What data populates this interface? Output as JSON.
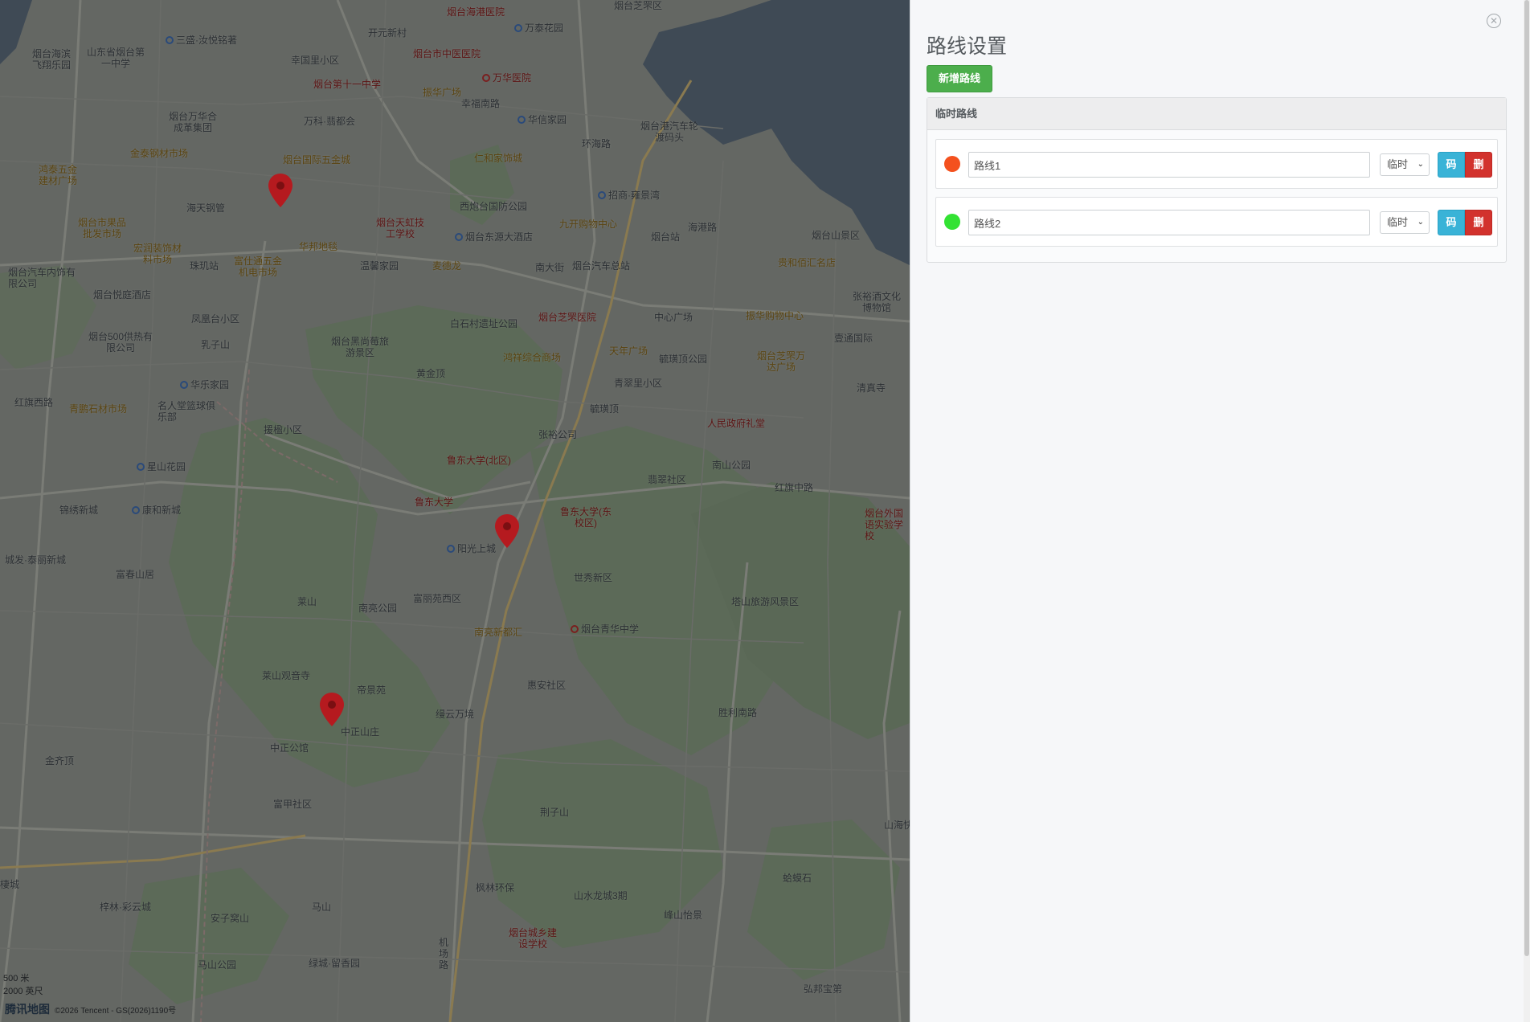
{
  "panel": {
    "title": "路线设置",
    "add_button": "新增路线",
    "close_symbol": "✕",
    "box_header": "临时路线",
    "routes": [
      {
        "color": "#f4511e",
        "name": "路线1",
        "type": "临时",
        "code_label": "码",
        "delete_label": "删"
      },
      {
        "color": "#33e233",
        "name": "路线2",
        "type": "临时",
        "code_label": "码",
        "delete_label": "删"
      }
    ]
  },
  "map": {
    "scale_metric": "500 米",
    "scale_imperial": "2000 英尺",
    "brand": "腾讯地图",
    "copyright": "©2026 Tencent - GS(2026)1190号",
    "markers": [
      "red-marker",
      "red-marker",
      "red-marker"
    ],
    "labels": [
      "烟台海港医院",
      "万泰花园",
      "烟台芝罘区",
      "开元新村",
      "烟台市中医医院",
      "三盛·汝悦铭著",
      "烟台海滨飞翔乐园",
      "山东省烟台第一中学",
      "幸国里小区",
      "烟台第十一中学",
      "万华医院",
      "振华广场",
      "幸福南路",
      "华信家园",
      "烟台港汽车轮渡码头",
      "环海路",
      "烟台万华合成革集团",
      "万科·翡都会",
      "仁和家饰城",
      "金泰钢材市场",
      "烟台国际五金城",
      "鸿泰五金建材广场",
      "海天钢管",
      "西炮台国防公园",
      "招商·雍景湾",
      "烟台市果品批发市场",
      "烟台天虹技工学校",
      "九开购物中心",
      "烟台山景区",
      "宏润装饰材料市场",
      "烟台东源大酒店",
      "烟台站",
      "海港路",
      "珠玑站",
      "富仕通五金机电市场",
      "华邦地毯",
      "温馨家园",
      "麦德龙",
      "南大街",
      "烟台汽车总站",
      "贵和佰汇名店",
      "烟台汽车内饰有限公司",
      "烟台悦庭酒店",
      "张裕酒文化博物馆",
      "凤凰台小区",
      "白石村遗址公园",
      "烟台芝罘医院",
      "中心广场",
      "振华购物中心",
      "壹通国际",
      "烟台500供热有限公司",
      "烟台黑尚莓旅游景区",
      "鸿祥综合商场",
      "天年广场",
      "毓璜顶公园",
      "烟台芝罘万达广场",
      "乳子山",
      "黄金顶",
      "青翠里小区",
      "清真寺",
      "华乐家园",
      "毓璜顶",
      "名人堂篮球俱乐部",
      "青鹏石材市场",
      "红旗西路",
      "援楹小区",
      "张裕公司",
      "人民政府礼堂",
      "鲁东大学(北区)",
      "南山公园",
      "翡翠社区",
      "红旗中路",
      "星山花园",
      "鲁东大学",
      "鲁东大学(东校区)",
      "烟台外国语实验学校",
      "锦绣新城",
      "康和新城",
      "阳光上城",
      "城发·泰丽新城",
      "富春山居",
      "世秀新区",
      "塔山旅游风景区",
      "莱山",
      "南亮公园",
      "富丽苑西区",
      "南亮新都汇",
      "烟台青华中学",
      "莱山观音寺",
      "帝景苑",
      "惠安社区",
      "中正山庄",
      "中正公馆",
      "缦云万境",
      "金齐顶",
      "胜利南路",
      "富甲社区",
      "荆子山",
      "山海快速路",
      "枫林环保",
      "山水龙城3期",
      "蛤蟆石",
      "梓林·彩云城",
      "安子窝山",
      "马山",
      "峰山怡景",
      "烟台城乡建设学校",
      "马山公园",
      "绿城·留香园",
      "机场路",
      "弘邦宝第",
      "棲城"
    ]
  }
}
